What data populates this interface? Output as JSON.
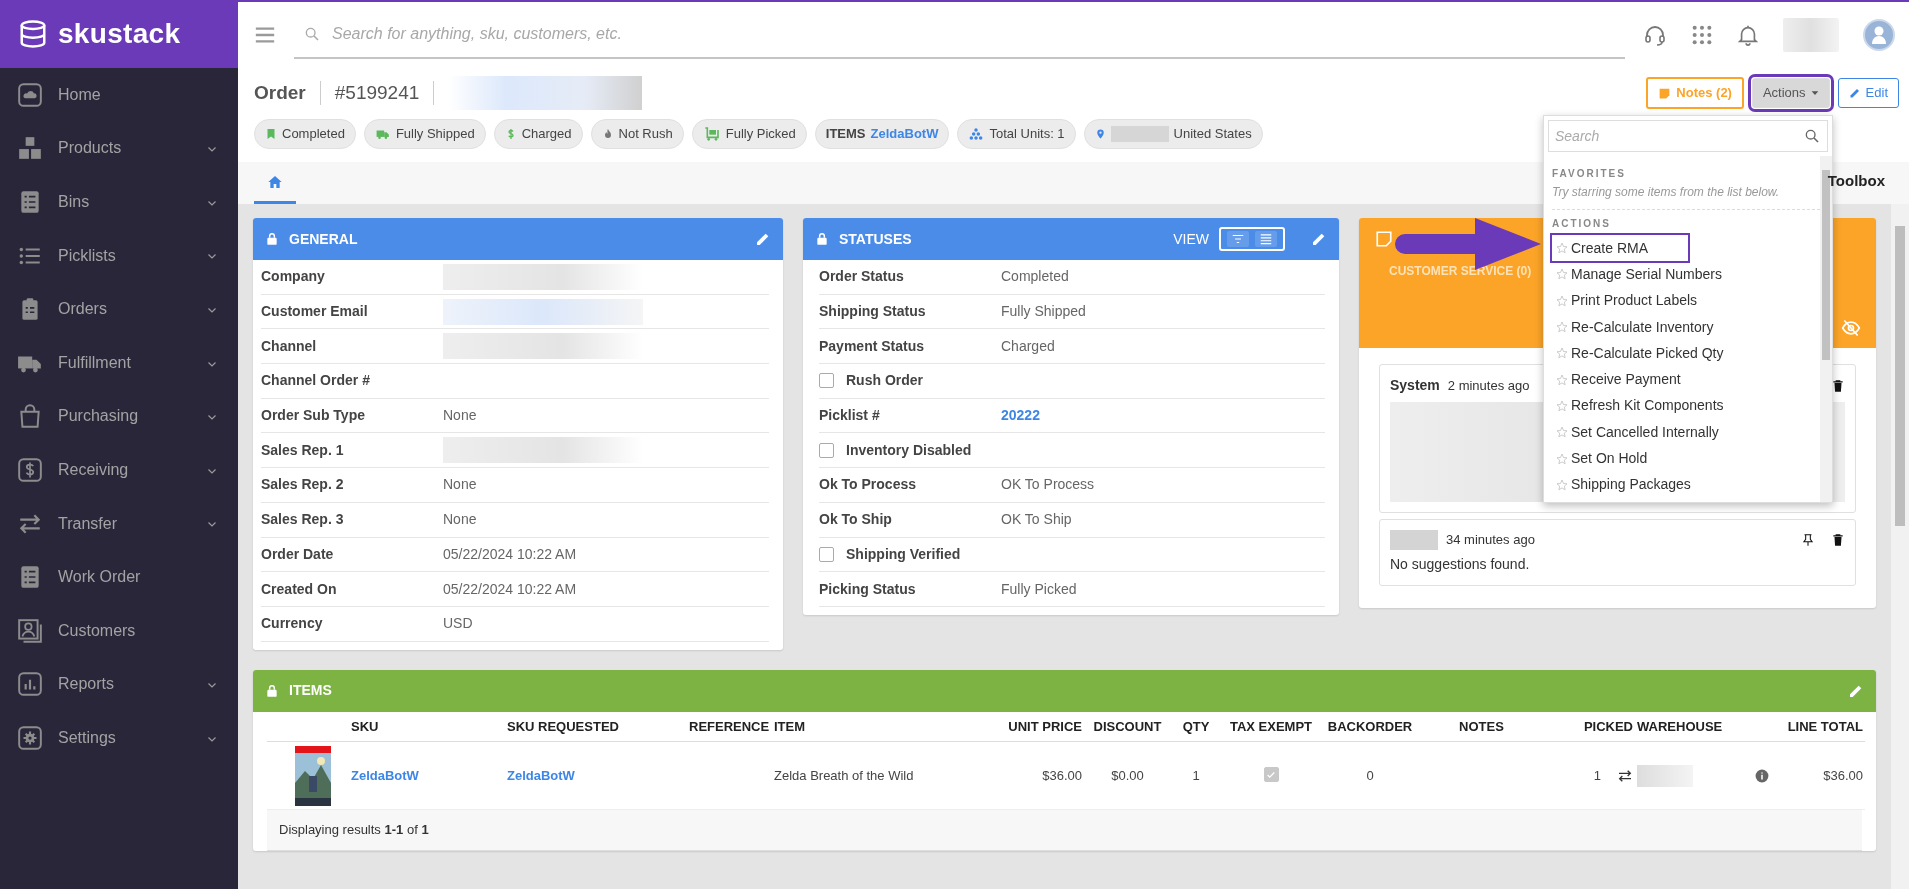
{
  "sidebar": {
    "logo": "skustack",
    "items": [
      {
        "label": "Home",
        "expandable": false
      },
      {
        "label": "Products",
        "expandable": true
      },
      {
        "label": "Bins",
        "expandable": true
      },
      {
        "label": "Picklists",
        "expandable": true
      },
      {
        "label": "Orders",
        "expandable": true
      },
      {
        "label": "Fulfillment",
        "expandable": true
      },
      {
        "label": "Purchasing",
        "expandable": true
      },
      {
        "label": "Receiving",
        "expandable": true
      },
      {
        "label": "Transfer",
        "expandable": true
      },
      {
        "label": "Work Order",
        "expandable": false
      },
      {
        "label": "Customers",
        "expandable": false
      },
      {
        "label": "Reports",
        "expandable": true
      },
      {
        "label": "Settings",
        "expandable": true
      }
    ]
  },
  "header": {
    "search": {
      "placeholder": "Search for anything, sku, customers, etc."
    }
  },
  "order": {
    "title": "Order",
    "number": "#5199241",
    "buttons": [
      {
        "kind": "notes",
        "label": "Notes (2)",
        "highlighted": false
      },
      {
        "kind": "actions",
        "label": "Actions",
        "highlighted": true
      },
      {
        "kind": "edit",
        "label": "Edit",
        "highlighted": false
      }
    ],
    "chips": [
      {
        "kind": "status",
        "label": "Completed"
      },
      {
        "kind": "status",
        "label": "Fully Shipped"
      },
      {
        "kind": "status",
        "label": "Charged"
      },
      {
        "kind": "status",
        "label": "Not Rush"
      },
      {
        "kind": "status",
        "label": "Fully Picked"
      },
      {
        "kind": "items",
        "label": "ITEMS",
        "value": "ZeldaBotW"
      },
      {
        "kind": "units",
        "label": "Total Units: 1"
      },
      {
        "kind": "location",
        "label": "United States"
      }
    ]
  },
  "tabs": [
    {
      "kind": "home",
      "selected": true
    },
    {
      "kind": "text",
      "label": "Toolbox",
      "selected": false
    }
  ],
  "general": {
    "title": "GENERAL",
    "rows": [
      {
        "label": "Company",
        "redacted": true
      },
      {
        "label": "Customer Email",
        "redacted": true
      },
      {
        "label": "Channel",
        "redacted": true
      },
      {
        "label": "Channel Order #"
      },
      {
        "label": "Order Sub Type",
        "value": "None"
      },
      {
        "label": "Sales Rep. 1",
        "redacted": true
      },
      {
        "label": "Sales Rep. 2",
        "value": "None"
      },
      {
        "label": "Sales Rep. 3",
        "value": "None"
      },
      {
        "label": "Order Date",
        "value": "05/22/2024 10:22 AM"
      },
      {
        "label": "Created On",
        "value": "05/22/2024 10:22 AM"
      },
      {
        "label": "Currency",
        "value": "USD"
      }
    ]
  },
  "statuses": {
    "title": "STATUSES",
    "view_label": "VIEW",
    "view_options": [
      {
        "kind": "filter",
        "selected": true
      },
      {
        "kind": "list",
        "selected": true
      }
    ],
    "rows": [
      {
        "kind": "text",
        "label": "Order Status",
        "value": "Completed"
      },
      {
        "kind": "text",
        "label": "Shipping Status",
        "value": "Fully Shipped"
      },
      {
        "kind": "text",
        "label": "Payment Status",
        "value": "Charged"
      },
      {
        "kind": "checkbox",
        "label": "Rush Order",
        "checked": false
      },
      {
        "kind": "link",
        "label": "Picklist #",
        "value": "20222"
      },
      {
        "kind": "checkbox",
        "label": "Inventory Disabled",
        "checked": false
      },
      {
        "kind": "text",
        "label": "Ok To Process",
        "value": "OK To Process"
      },
      {
        "kind": "text",
        "label": "Ok To Ship",
        "value": "OK To Ship"
      },
      {
        "kind": "checkbox",
        "label": "Shipping Verified",
        "checked": false
      },
      {
        "kind": "text",
        "label": "Picking Status",
        "value": "Fully Picked"
      }
    ]
  },
  "notes_panel": {
    "tab": "CUSTOMER SERVICE (0)",
    "notes": [
      {
        "author": "System",
        "time": "2 minutes ago",
        "redacted_body": true
      },
      {
        "author_redacted": true,
        "time": "34 minutes ago",
        "text": "No suggestions found.",
        "pin": true
      }
    ]
  },
  "actions_menu": {
    "search": {
      "placeholder": "Search"
    },
    "favorites_heading": "FAVORITES",
    "favorites_hint": "Try starring some items from the list below.",
    "actions_heading": "ACTIONS",
    "items": [
      {
        "label": "Create RMA",
        "highlighted": true
      },
      {
        "label": "Manage Serial Numbers",
        "highlighted": false
      },
      {
        "label": "Print Product Labels",
        "highlighted": false
      },
      {
        "label": "Re-Calculate Inventory",
        "highlighted": false
      },
      {
        "label": "Re-Calculate Picked Qty",
        "highlighted": false
      },
      {
        "label": "Receive Payment",
        "highlighted": false
      },
      {
        "label": "Refresh Kit Components",
        "highlighted": false
      },
      {
        "label": "Set Cancelled Internally",
        "highlighted": false
      },
      {
        "label": "Set On Hold",
        "highlighted": false
      },
      {
        "label": "Shipping Packages",
        "highlighted": false
      }
    ]
  },
  "items": {
    "title": "ITEMS",
    "columns": [
      "SKU",
      "SKU REQUESTED",
      "REFERENCE",
      "ITEM",
      "UNIT PRICE",
      "DISCOUNT",
      "QTY",
      "TAX EXEMPT",
      "BACKORDER",
      "NOTES",
      "PICKED",
      "WAREHOUSE",
      "LINE TOTAL"
    ],
    "rows": [
      {
        "sku": "ZeldaBotW",
        "sku_requested": "ZeldaBotW",
        "item": "Zelda Breath of the Wild",
        "unit_price": "$36.00",
        "discount": "$0.00",
        "qty": "1",
        "tax_exempt": true,
        "backorder": "0",
        "picked": "1",
        "warehouse_redacted": true,
        "line_total": "$36.00"
      }
    ],
    "footer": "Displaying results **1-1** of **1**"
  }
}
